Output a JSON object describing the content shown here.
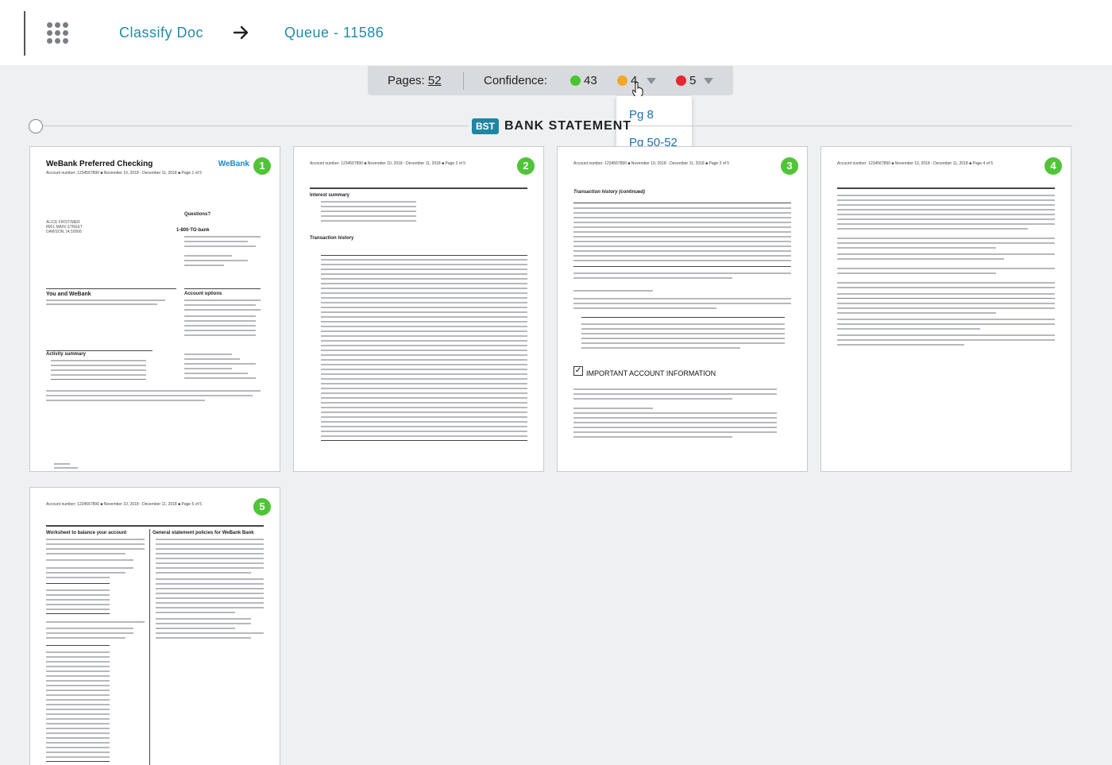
{
  "header": {
    "breadcrumb": [
      "Classify Doc",
      "Queue - 11586"
    ]
  },
  "toolbar": {
    "pages_label": "Pages:",
    "pages_value": "52",
    "confidence_label": "Confidence:",
    "green_count": "43",
    "orange_count": "4",
    "red_count": "5"
  },
  "dropdown": {
    "items": [
      "Pg 8",
      "Pg 50-52"
    ]
  },
  "section": {
    "badge": "BST",
    "title": "BANK STATEMENT"
  },
  "pages": [
    {
      "number": "1",
      "title": "WeBank Preferred Checking",
      "header": "Account number: 1234567890 ■ November 10, 2018 - December 11, 2018    ■ Page 1 of 5",
      "logo": "WeBank",
      "address": [
        "ALICE FIRSTIMER",
        "8901 MAIN STREET",
        "DAWSON, IA 50066"
      ],
      "questions": "Questions?",
      "phone": "1-800-TO-bank",
      "you_and": "You and WeBank",
      "account_options": "Account options",
      "activity": "Activity summary"
    },
    {
      "number": "2",
      "header": "Account number: 1234567890 ■ November 10, 2018 - December 11, 2018    ■ Page 2 of 5",
      "interest": "Interest summary",
      "transactions": "Transaction history"
    },
    {
      "number": "3",
      "header": "Account number: 1234567890 ■ November 10, 2018 - December 11, 2018    ■ Page 3 of 5",
      "transactions": "Transaction history (continued)",
      "important": "IMPORTANT ACCOUNT INFORMATION"
    },
    {
      "number": "4",
      "header": "Account number: 1234567890 ■ November 10, 2018 - December 11, 2018    ■ Page 4 of 5"
    },
    {
      "number": "5",
      "header": "Account number: 1234567890 ■ November 10, 2018 - December 11, 2018    ■ Page 5 of 5",
      "worksheet": "Worksheet to balance your account",
      "policies": "General statement policies for WeBank Bank"
    }
  ]
}
